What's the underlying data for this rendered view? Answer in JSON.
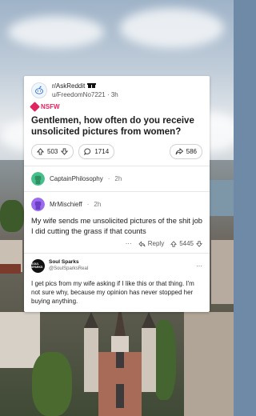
{
  "post": {
    "subreddit": "r/AskReddit",
    "author": "u/FreedomNo7221",
    "time": "3h",
    "nsfw_label": "NSFW",
    "title": "Gentlemen, how often do you receive unsolicited pictures from women?",
    "upvotes": "503",
    "comments": "1714",
    "shares": "586"
  },
  "comments": [
    {
      "author": "CaptainPhilosophy",
      "time": "2h"
    },
    {
      "author": "MrMischieff",
      "time": "2h",
      "body": "My wife sends me unsolicited pictures of the shit job I did cutting the grass if that counts",
      "more": "···",
      "reply_label": "Reply",
      "votes": "5445"
    }
  ],
  "tweet": {
    "name": "Soul Sparks",
    "handle": "@SoulSparksReal",
    "more": "···",
    "body": "I get pics from my wife asking if I like this or that thing. I'm not sure why, because my opinion has never stopped her buying anything.",
    "avatar_logo_text": "SOUL SPARKS"
  },
  "icons": {
    "subreddit": "askreddit-alien-icon",
    "nsfw": "nsfw-icon",
    "upvote": "upvote-arrow-icon",
    "downvote": "downvote-arrow-icon",
    "comments": "comment-bubble-icon",
    "share": "share-arrow-icon",
    "reply": "reply-arrow-icon"
  },
  "colors": {
    "nsfw": "#e0245e",
    "card": "#ffffff",
    "text": "#1c1c1c",
    "avatar_captain": "#46c08a",
    "avatar_mischief": "#9b6cf0"
  }
}
